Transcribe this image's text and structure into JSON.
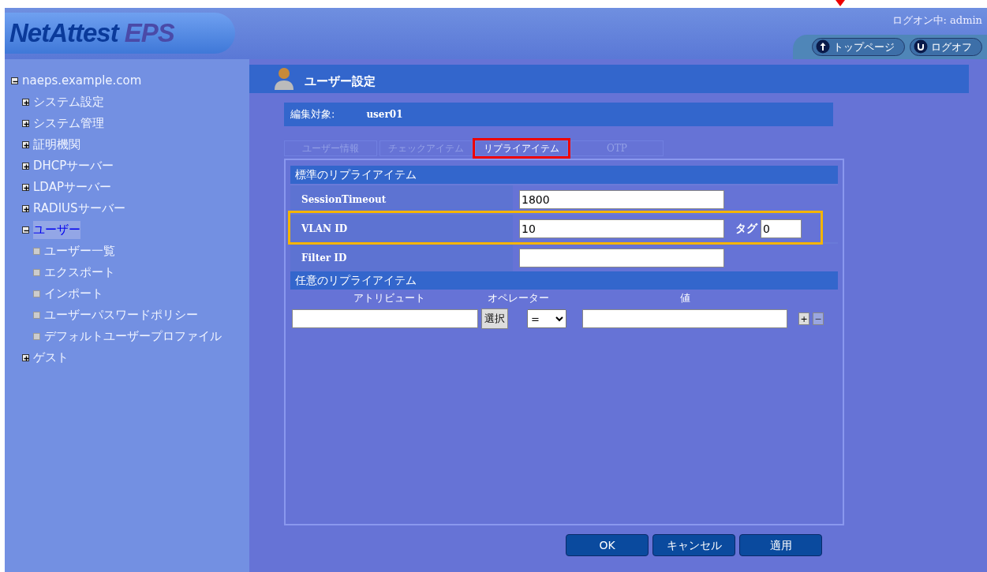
{
  "header": {
    "logo": {
      "main": "NetAttest",
      "sub": "EPS"
    },
    "login_status": "ログオン中: admin",
    "buttons": [
      {
        "label": "トップページ",
        "kind": "up"
      },
      {
        "label": "ログオフ",
        "kind": "back"
      }
    ]
  },
  "sidebar": {
    "tree": [
      {
        "label": "naeps.example.com",
        "expanded": true,
        "selected": false,
        "children": [
          {
            "label": "システム設定",
            "expanded": false,
            "selected": false
          },
          {
            "label": "システム管理",
            "expanded": false,
            "selected": false
          },
          {
            "label": "証明機関",
            "expanded": false,
            "selected": false
          },
          {
            "label": "DHCPサーバー",
            "expanded": false,
            "selected": false
          },
          {
            "label": "LDAPサーバー",
            "expanded": false,
            "selected": false
          },
          {
            "label": "RADIUSサーバー",
            "expanded": false,
            "selected": false
          },
          {
            "label": "ユーザー",
            "expanded": true,
            "selected": true,
            "children": [
              {
                "label": "ユーザー一覧",
                "selected": false
              },
              {
                "label": "エクスポート",
                "selected": false
              },
              {
                "label": "インポート",
                "selected": false
              },
              {
                "label": "ユーザーパスワードポリシー",
                "selected": false
              },
              {
                "label": "デフォルトユーザープロファイル",
                "selected": false
              }
            ]
          },
          {
            "label": "ゲスト",
            "expanded": false,
            "selected": false
          }
        ]
      }
    ]
  },
  "page": {
    "title": "ユーザー設定",
    "target_label": "編集対象:",
    "target_value": "user01",
    "tabs": [
      {
        "label": "ユーザー情報",
        "selected": false,
        "highlighted": false
      },
      {
        "label": "チェックアイテム",
        "selected": false,
        "highlighted": false
      },
      {
        "label": "リプライアイテム",
        "selected": true,
        "highlighted": true
      },
      {
        "label": "OTP",
        "selected": false,
        "highlighted": false
      }
    ],
    "standard_section": {
      "title": "標準のリプライアイテム",
      "rows": [
        {
          "label": "SessionTimeout",
          "value": "1800",
          "highlighted": false
        },
        {
          "label": "VLAN ID",
          "value": "10",
          "highlighted": true,
          "tag_label": "タグ",
          "tag_value": "0"
        },
        {
          "label": "Filter ID",
          "highlighted": false
        }
      ]
    },
    "custom_section": {
      "title": "任意のリプライアイテム",
      "columns": [
        "アトリビュート",
        "オペレーター",
        "値"
      ],
      "select_button": "選択",
      "operator": "=",
      "add_button": "+",
      "remove_button": "−"
    },
    "buttons": [
      "OK",
      "キャンセル",
      "適用"
    ]
  }
}
